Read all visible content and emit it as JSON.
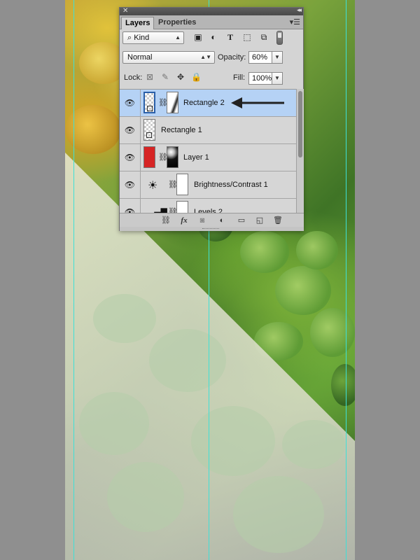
{
  "panel": {
    "tabs": [
      {
        "label": "Layers",
        "active": true
      },
      {
        "label": "Properties",
        "active": false
      }
    ],
    "filter": {
      "kind_label": "Kind"
    },
    "blend_mode": "Normal",
    "opacity_label": "Opacity:",
    "opacity_value": "60%",
    "lock_label": "Lock:",
    "fill_label": "Fill:",
    "fill_value": "100%",
    "layers": [
      {
        "name": "Rectangle 2",
        "selected": true,
        "visible": true
      },
      {
        "name": "Rectangle 1",
        "selected": false,
        "visible": true
      },
      {
        "name": "Layer 1",
        "selected": false,
        "visible": true
      },
      {
        "name": "Brightness/Contrast 1",
        "selected": false,
        "visible": true
      },
      {
        "name": "Levels 2",
        "selected": false,
        "visible": true
      }
    ],
    "bottom_fx_label": "fx"
  },
  "icons": {
    "close": "close-icon",
    "panel_menu": "panel-menu-icon",
    "eye": "eye-icon",
    "chain": "link-icon",
    "brightness": "brightness-icon",
    "levels": "levels-icon"
  },
  "colors": {
    "selection": "#b5d2f5",
    "guide": "#3de0d8",
    "layer1_fill": "#d62424"
  }
}
